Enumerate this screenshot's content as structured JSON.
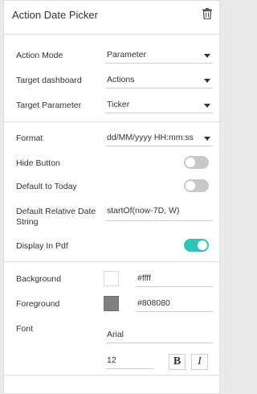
{
  "header": {
    "title": "Action Date Picker",
    "delete_icon": "trash-icon"
  },
  "action": {
    "mode_label": "Action Mode",
    "mode_value": "Parameter",
    "dashboard_label": "Target dashboard",
    "dashboard_value": "Actions",
    "parameter_label": "Target Parameter",
    "parameter_value": "Ticker"
  },
  "options": {
    "format_label": "Format",
    "format_value": "dd/MM/yyyy HH:mm:ss",
    "hide_button_label": "Hide Button",
    "hide_button_on": false,
    "default_today_label": "Default to Today",
    "default_today_on": false,
    "relative_label_line1": "Default Relative Date",
    "relative_label_line2": "String",
    "relative_value": "startOf(now-7D, W)",
    "display_pdf_label": "Display In Pdf",
    "display_pdf_on": true
  },
  "style": {
    "background_label": "Background",
    "background_value": "#ffff",
    "background_color": "#ffffff",
    "foreground_label": "Foreground",
    "foreground_value": "#808080",
    "foreground_color": "#808080",
    "font_label": "Font",
    "font_value": "Arial",
    "font_size": "12",
    "bold_label": "B",
    "italic_label": "I"
  },
  "colors": {
    "accent": "#2ec4b6",
    "toggle_off": "#c8c8c8"
  }
}
